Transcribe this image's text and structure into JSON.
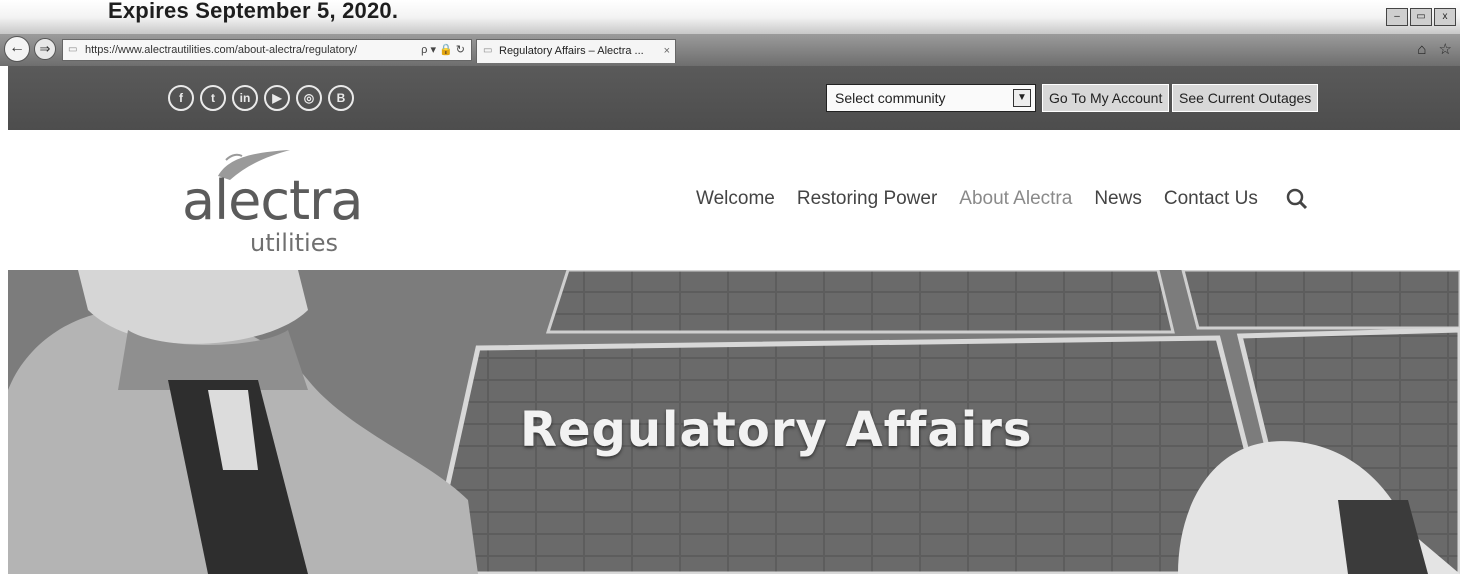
{
  "print_header": {
    "expires_text": "Expires September 5, 2020."
  },
  "browser": {
    "back_glyph": "←",
    "forward_glyph": "⇒",
    "url": "https://www.alectrautilities.com/about-alectra/regulatory/",
    "address_tools": "ρ ▾ 🔒 ↻",
    "tab_title": "Regulatory Affairs – Alectra ...",
    "tab_close": "×",
    "window_controls": [
      "–",
      "▭",
      "x"
    ],
    "toolbar_icons": "⌂ ☆"
  },
  "topbar": {
    "social_icons": [
      {
        "name": "facebook-icon",
        "glyph": "f"
      },
      {
        "name": "twitter-icon",
        "glyph": "t"
      },
      {
        "name": "linkedin-icon",
        "glyph": "in"
      },
      {
        "name": "youtube-icon",
        "glyph": "▶"
      },
      {
        "name": "instagram-icon",
        "glyph": "◎"
      },
      {
        "name": "blog-icon",
        "glyph": "B"
      }
    ],
    "community_select": {
      "selected": "Select community"
    },
    "account_button": "Go To My Account",
    "outages_button": "See Current Outages"
  },
  "brand": {
    "name": "alectra",
    "sub": "utilities"
  },
  "nav": {
    "items": [
      "Welcome",
      "Restoring Power",
      "About Alectra",
      "News",
      "Contact Us"
    ],
    "active": "About Alectra",
    "search_icon": "search-icon"
  },
  "hero": {
    "title": "Regulatory Affairs"
  }
}
